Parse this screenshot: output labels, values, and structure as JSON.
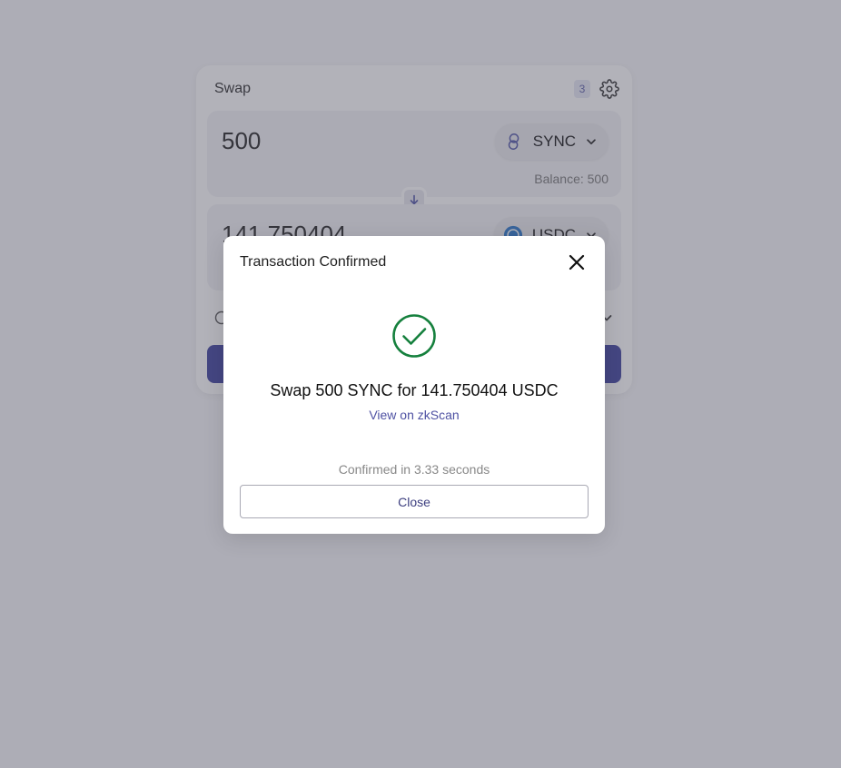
{
  "swap": {
    "title": "Swap",
    "settings_badge": "3",
    "from": {
      "amount": "500",
      "token": "SYNC",
      "balance": "Balance: 500"
    },
    "to": {
      "amount": "141.750404",
      "token": "USDC"
    }
  },
  "modal": {
    "title": "Transaction Confirmed",
    "summary": "Swap 500 SYNC for 141.750404 USDC",
    "link": "View on zkScan",
    "confirmed_text": "Confirmed in 3.33 seconds",
    "close_label": "Close"
  },
  "colors": {
    "accent": "#3c3f9e",
    "success": "#15803d",
    "overlay": "#505060"
  },
  "icons": {
    "settings": "gear-icon",
    "from_token": "sync-token-icon",
    "to_token": "usdc-token-icon",
    "switch": "arrow-down-icon",
    "close": "close-icon",
    "success": "check-circle-icon"
  }
}
